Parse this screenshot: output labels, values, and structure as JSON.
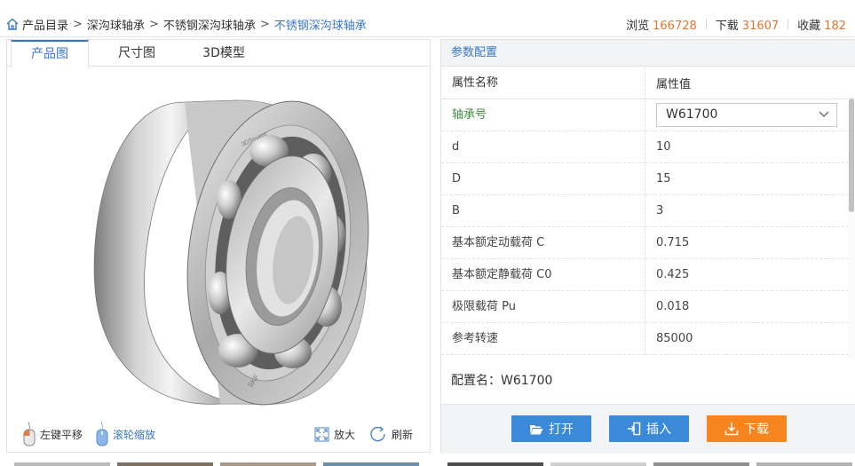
{
  "breadcrumb": {
    "items": [
      "产品目录",
      "深沟球轴承",
      "不锈钢深沟球轴承"
    ],
    "current": "不锈钢深沟球轴承",
    "separator": ">"
  },
  "stats": {
    "views_label": "浏览",
    "views": "166728",
    "downloads_label": "下载",
    "downloads": "31607",
    "favorites_label": "收藏",
    "favorites": "182"
  },
  "tabs": [
    "产品图",
    "尺寸图",
    "3D模型"
  ],
  "viewer": {
    "bearing_marking_top": "3DSource",
    "bearing_marking_bottom": "SKF",
    "controls": {
      "pan_label": "左键平移",
      "zoom_wheel_label": "滚轮缩放",
      "enlarge_label": "放大",
      "refresh_label": "刷新"
    }
  },
  "params": {
    "title": "参数配置",
    "header": {
      "name": "属性名称",
      "value": "属性值"
    },
    "bearing_no_label": "轴承号",
    "bearing_no_value": "W61700",
    "rows": [
      {
        "k": "d",
        "v": "10"
      },
      {
        "k": "D",
        "v": "15"
      },
      {
        "k": "B",
        "v": "3"
      },
      {
        "k": "基本额定动载荷 C",
        "v": "0.715"
      },
      {
        "k": "基本额定静载荷 C0",
        "v": "0.425"
      },
      {
        "k": "极限载荷 Pu",
        "v": "0.018"
      },
      {
        "k": "参考转速",
        "v": "85000"
      }
    ],
    "config_name": "配置名：W61700"
  },
  "actions": {
    "open": "打开",
    "insert": "插入",
    "download": "下载"
  },
  "colors": {
    "accent_blue": "#3a76c4",
    "button_blue": "#3b8ad9",
    "button_orange": "#f7851f",
    "stat_orange": "#e8742c",
    "green_label": "#3e8e3e"
  }
}
